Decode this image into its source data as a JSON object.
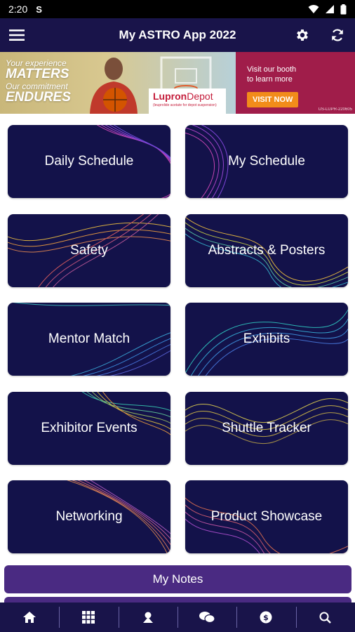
{
  "status_bar": {
    "time": "2:20",
    "carrier_glyph": "S"
  },
  "app_bar": {
    "title": "My ASTRO App 2022"
  },
  "banner": {
    "line1": "Your experience",
    "line2": "MATTERS",
    "line3": "Our commitment",
    "line4": "ENDURES",
    "brand_a": "Lupron",
    "brand_b": "Depot",
    "brand_tag": "(leuprolide acetate for depot suspension)",
    "visit_line1": "Visit our booth",
    "visit_line2": "to learn more",
    "visit_button": "VISIT NOW",
    "code": "US-LUPR-220605"
  },
  "tiles": [
    {
      "label": "Daily Schedule"
    },
    {
      "label": "My Schedule"
    },
    {
      "label": "Safety"
    },
    {
      "label": "Abstracts & Posters"
    },
    {
      "label": "Mentor Match"
    },
    {
      "label": "Exhibits"
    },
    {
      "label": "Exhibitor Events"
    },
    {
      "label": "Shuttle Tracker"
    },
    {
      "label": "Networking"
    },
    {
      "label": "Product Showcase"
    }
  ],
  "notes": {
    "label": "My Notes"
  },
  "bottom_nav": [
    "home-icon",
    "grid-icon",
    "map-pin-icon",
    "chat-icon",
    "dollar-icon",
    "search-icon"
  ],
  "colors": {
    "app_bar": "#19144a",
    "tile": "#13124a",
    "notes": "#4a2a82",
    "banner_right": "#a01d4a",
    "visit_button": "#f28c1a"
  }
}
